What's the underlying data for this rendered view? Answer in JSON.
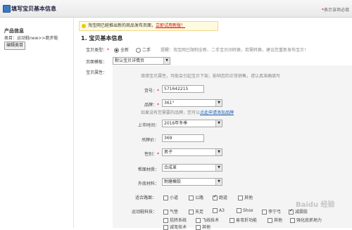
{
  "header": {
    "title": "填写宝贝基本信息",
    "required_note_star": "*",
    "required_note": "表示该项必填"
  },
  "sidebar": {
    "heading": "产品信息",
    "category": "类目：运动鞋new>>跑步鞋",
    "edit_button": "编辑类目"
  },
  "notice": {
    "text": "淘宝网已經推出新的商品发布页面，",
    "link": "立即试用新版！"
  },
  "section_title": "1. 宝贝基本信息",
  "form": {
    "type_label": "宝贝类型：",
    "type_options": [
      "全新",
      "二手"
    ],
    "type_hint": "提醒：淘宝网已限制全新、二手宝贝间转换，若需转换，建议您重新发布宝贝！",
    "template_label": "页面模板：",
    "template_value": "默认宝贝详情页",
    "attr_label": "宝贝属性：",
    "attr_hint": "填错宝贝属性，可能会引起宝贝下架，影响您的正常销售。请认真准确填写",
    "model_label": "货号：",
    "model_value": "571642215",
    "brand_label": "品牌：",
    "brand_value": "361°",
    "brand_hint": "如果没有您需要的品牌，您可以",
    "brand_link": "点此申请添加品牌",
    "season_label": "上市时间：",
    "season_value": "2016年冬季",
    "price_label": "吊牌价：",
    "price_value": "369",
    "gender_label": "性别：",
    "gender_value": "男子",
    "upper_label": "帮面材质：",
    "upper_value": "合成革",
    "sole_label": "外底材料：",
    "sole_value": "耐磨橡胶",
    "terrain_label": "适合路面：",
    "terrain_options": [
      {
        "label": "小道",
        "checked": false
      },
      {
        "label": "公路",
        "checked": false
      },
      {
        "label": "跑道",
        "checked": true
      },
      {
        "label": "其他",
        "checked": false
      }
    ],
    "tech_label": "运动鞋科技：",
    "tech_row1": [
      {
        "label": "气垫",
        "checked": false
      },
      {
        "label": "天足",
        "checked": false
      },
      {
        "label": "A3",
        "checked": false
      },
      {
        "label": "Shox",
        "checked": false
      },
      {
        "label": "李宁弓",
        "checked": false
      },
      {
        "label": "减震胶",
        "checked": true
      }
    ],
    "tech_row2": [
      {
        "label": "括转系统",
        "checked": false
      },
      {
        "label": "飞线技术",
        "checked": false
      },
      {
        "label": "易弯折功能",
        "checked": false
      },
      {
        "label": "其他",
        "checked": false
      },
      {
        "label": "强化底抓地力",
        "checked": false
      }
    ],
    "tech_row3": [
      {
        "label": "减弯技术",
        "checked": false
      },
      {
        "label": "其他",
        "checked": false
      }
    ]
  },
  "watermark": "Baidu 经验"
}
